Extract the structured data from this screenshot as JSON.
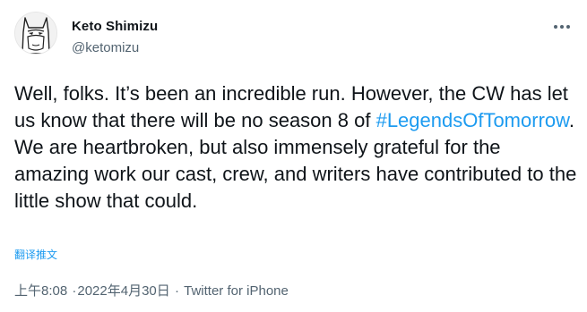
{
  "author": {
    "name": "Keto Shimizu",
    "handle": "@ketomizu",
    "avatar_icon": "batman-cartoon-avatar-icon"
  },
  "menu": {
    "icon": "more-horizontal-icon"
  },
  "tweet": {
    "text_before": "Well, folks. It’s been an incredible run. However, the CW has let us know that there will be no season 8 of ",
    "hashtag": "#LegendsOfTomorrow",
    "text_after": ". We are heartbroken, but also immensely grateful for the amazing work our cast, crew, and writers have contributed to the little show that could.",
    "translate_label": "翻译推文"
  },
  "meta": {
    "time": "上午8:08",
    "separator1": "·",
    "date": "2022年4月30日",
    "separator2": "·",
    "source": "Twitter for iPhone"
  },
  "colors": {
    "link": "#1d9bf0",
    "secondary_text": "#536471",
    "primary_text": "#0f1419"
  }
}
